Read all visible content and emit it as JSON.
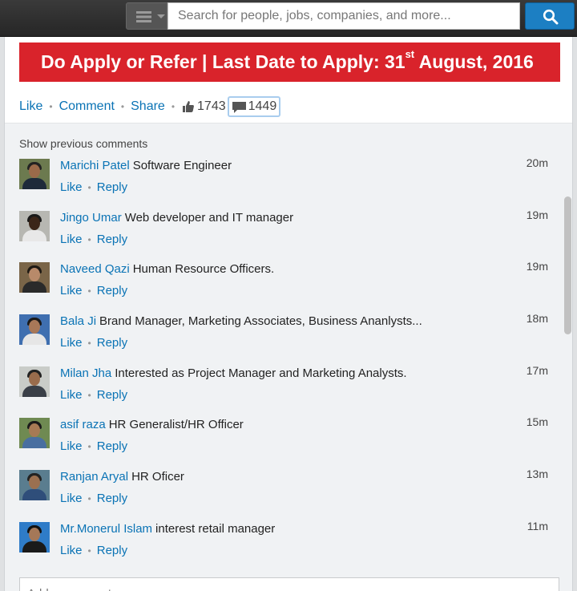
{
  "search": {
    "placeholder": "Search for people, jobs, companies, and more..."
  },
  "post": {
    "banner_main": "Do Apply or Refer | Last Date to Apply: 31",
    "banner_sup": "st",
    "banner_end": " August, 2016"
  },
  "actions": {
    "like": "Like",
    "comment": "Comment",
    "share": "Share",
    "like_count": "1743",
    "comment_count": "1449"
  },
  "comments": {
    "show_previous": "Show previous comments",
    "like_label": "Like",
    "reply_label": "Reply",
    "add_placeholder": "Add a comment...",
    "items": [
      {
        "name": "Marichi Patel",
        "text": "Software Engineer",
        "time": "20m"
      },
      {
        "name": "Jingo Umar",
        "text": "Web developer and IT manager",
        "time": "19m"
      },
      {
        "name": "Naveed Qazi",
        "text": "Human Resource Officers.",
        "time": "19m"
      },
      {
        "name": "Bala Ji",
        "text": "Brand Manager, Marketing Associates, Business Ananlysts...",
        "time": "18m"
      },
      {
        "name": "Milan Jha",
        "text": "Interested as Project Manager and Marketing Analysts.",
        "time": "17m"
      },
      {
        "name": "asif raza",
        "text": "HR Generalist/HR Officer",
        "time": "15m"
      },
      {
        "name": "Ranjan Aryal",
        "text": "HR Oficer",
        "time": "13m"
      },
      {
        "name": "Mr.Monerul Islam",
        "text": "interest retail manager",
        "time": "11m"
      }
    ]
  },
  "colors": {
    "link": "#0a73b5",
    "banner": "#d9232b",
    "search_button": "#1c7fc3"
  }
}
